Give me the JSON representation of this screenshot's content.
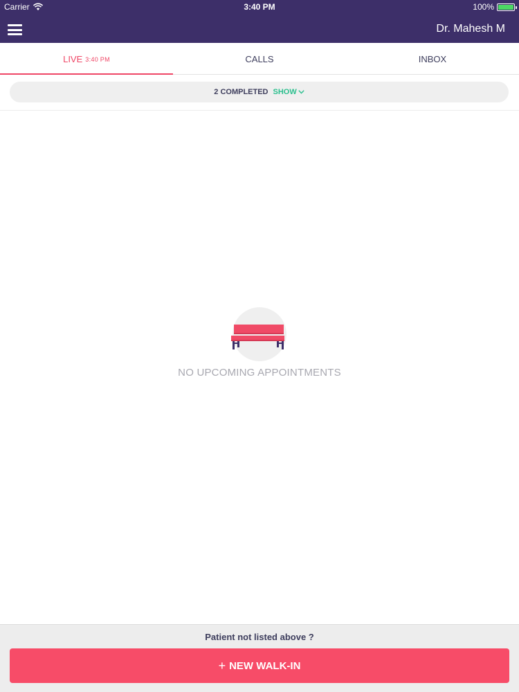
{
  "status_bar": {
    "carrier": "Carrier",
    "time": "3:40 PM",
    "battery": "100%"
  },
  "header": {
    "user_name": "Dr. Mahesh M",
    "menu_icon": "hamburger-menu-icon"
  },
  "tabs": [
    {
      "label": "LIVE",
      "time": "3:40 PM",
      "active": true
    },
    {
      "label": "CALLS",
      "active": false
    },
    {
      "label": "INBOX",
      "active": false
    }
  ],
  "completed": {
    "label": "2 COMPLETED",
    "toggle": "SHOW",
    "toggle_icon": "chevron-down-icon"
  },
  "empty_state": {
    "icon": "bench-icon",
    "message": "NO UPCOMING APPOINTMENTS"
  },
  "footer": {
    "prompt": "Patient not listed above ?",
    "button_icon": "plus-icon",
    "button_plus": "+",
    "button_label": "NEW WALK-IN"
  },
  "colors": {
    "header_bg": "#3d2f69",
    "accent": "#ef4565",
    "show_green": "#2bbf8e",
    "button_bg": "#f74c68",
    "battery": "#4cd964"
  }
}
